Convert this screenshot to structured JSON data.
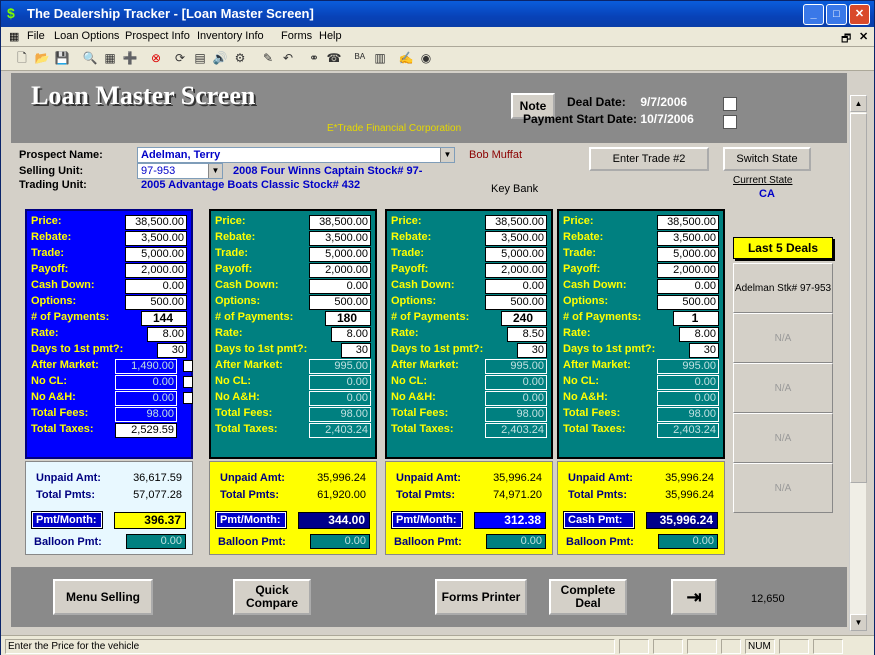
{
  "window": {
    "title": "The Dealership Tracker - [Loan Master Screen]"
  },
  "menu": [
    "File",
    "Loan Options",
    "Prospect Info",
    "Inventory Info",
    "Forms",
    "Help"
  ],
  "header": {
    "title": "Loan Master Screen",
    "subtitle": "E*Trade Financial Corporation",
    "note_button": "Note",
    "deal_date_label": "Deal Date:",
    "deal_date": "9/7/2006",
    "payment_start_label": "Payment Start Date:",
    "payment_start": "10/7/2006"
  },
  "info": {
    "prospect_label": "Prospect Name:",
    "prospect_value": "Adelman, Terry",
    "salesperson": "Bob Muffat",
    "selling_label": "Selling Unit:",
    "selling_code": "97-953",
    "selling_desc": "2008  Four Winns Captain  Stock# 97-",
    "trading_label": "Trading Unit:",
    "trading_desc": "2005 Advantage Boats Classic Stock# 432",
    "bank": "Key Bank",
    "enter_trade_button": "Enter Trade #2",
    "switch_state_button": "Switch State",
    "current_state_label": "Current State",
    "current_state": "CA"
  },
  "labels": {
    "price": "Price:",
    "rebate": "Rebate:",
    "trade": "Trade:",
    "payoff": "Payoff:",
    "cash_down": "Cash Down:",
    "options": "Options:",
    "num_payments": "# of Payments:",
    "rate": "Rate:",
    "days_first": "Days to 1st pmt?:",
    "after_market": "After Market:",
    "no_cl": "No CL:",
    "no_ah": "No A&H:",
    "total_fees": "Total Fees:",
    "total_taxes": "Total Taxes:",
    "unpaid": "Unpaid Amt:",
    "total_pmts": "Total Pmts:",
    "balloon": "Balloon Pmt:"
  },
  "panels": [
    {
      "price": "38,500.00",
      "rebate": "3,500.00",
      "trade": "5,000.00",
      "payoff": "2,000.00",
      "cash_down": "0.00",
      "options": "500.00",
      "num_payments": "144",
      "rate": "8.00",
      "days_first": "30",
      "after_market": "1,490.00",
      "no_cl": "0.00",
      "no_ah": "0.00",
      "total_fees": "98.00",
      "total_taxes": "2,529.59",
      "unpaid": "36,617.59",
      "total_pmts": "57,077.28",
      "pmt_label": "Pmt/Month:",
      "pmt_value": "396.37",
      "balloon": "0.00"
    },
    {
      "price": "38,500.00",
      "rebate": "3,500.00",
      "trade": "5,000.00",
      "payoff": "2,000.00",
      "cash_down": "0.00",
      "options": "500.00",
      "num_payments": "180",
      "rate": "8.00",
      "days_first": "30",
      "after_market": "995.00",
      "no_cl": "0.00",
      "no_ah": "0.00",
      "total_fees": "98.00",
      "total_taxes": "2,403.24",
      "unpaid": "35,996.24",
      "total_pmts": "61,920.00",
      "pmt_label": "Pmt/Month:",
      "pmt_value": "344.00",
      "balloon": "0.00"
    },
    {
      "price": "38,500.00",
      "rebate": "3,500.00",
      "trade": "5,000.00",
      "payoff": "2,000.00",
      "cash_down": "0.00",
      "options": "500.00",
      "num_payments": "240",
      "rate": "8.50",
      "days_first": "30",
      "after_market": "995.00",
      "no_cl": "0.00",
      "no_ah": "0.00",
      "total_fees": "98.00",
      "total_taxes": "2,403.24",
      "unpaid": "35,996.24",
      "total_pmts": "74,971.20",
      "pmt_label": "Pmt/Month:",
      "pmt_value": "312.38",
      "balloon": "0.00"
    },
    {
      "price": "38,500.00",
      "rebate": "3,500.00",
      "trade": "5,000.00",
      "payoff": "2,000.00",
      "cash_down": "0.00",
      "options": "500.00",
      "num_payments": "1",
      "rate": "8.00",
      "days_first": "30",
      "after_market": "995.00",
      "no_cl": "0.00",
      "no_ah": "0.00",
      "total_fees": "98.00",
      "total_taxes": "2,403.24",
      "unpaid": "35,996.24",
      "total_pmts": "35,996.24",
      "pmt_label": "Cash Pmt:",
      "pmt_value": "35,996.24",
      "balloon": "0.00"
    }
  ],
  "deals": {
    "header": "Last 5 Deals",
    "items": [
      "Adelman Stk# 97-953",
      "N/A",
      "N/A",
      "N/A",
      "N/A"
    ]
  },
  "bottom": {
    "menu_selling": "Menu Selling",
    "quick_compare": "Quick Compare",
    "forms_printer": "Forms Printer",
    "complete_deal": "Complete Deal",
    "count": "12,650"
  },
  "status": {
    "message": "Enter the Price for the vehicle",
    "num": "NUM"
  }
}
